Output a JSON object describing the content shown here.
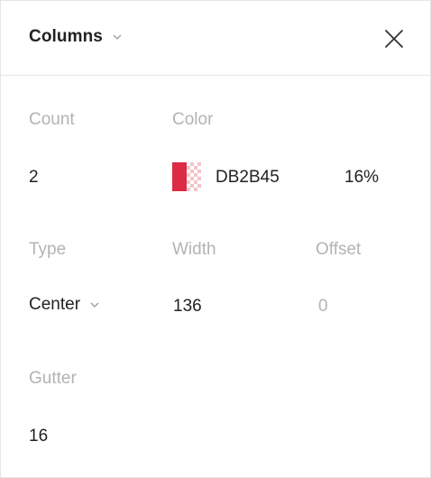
{
  "header": {
    "title": "Columns",
    "dropdown_icon": "chevron-down-icon",
    "close_icon": "close-icon"
  },
  "fields": {
    "count": {
      "label": "Count",
      "value": "2"
    },
    "color": {
      "label": "Color",
      "hex": "DB2B45",
      "opacity": "16%",
      "swatch_color": "#DB2B45"
    },
    "type": {
      "label": "Type",
      "value": "Center"
    },
    "width": {
      "label": "Width",
      "value": "136"
    },
    "offset": {
      "label": "Offset",
      "value": "0"
    },
    "gutter": {
      "label": "Gutter",
      "value": "16"
    }
  }
}
